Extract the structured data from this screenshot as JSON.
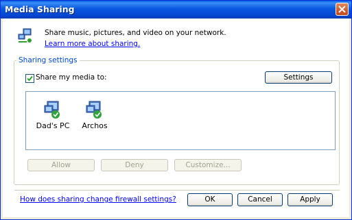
{
  "window": {
    "title": "Media Sharing"
  },
  "intro": {
    "text": "Share music, pictures, and video on your network.",
    "learn_more_link": "Learn more about sharing."
  },
  "sharing_settings": {
    "legend": "Sharing settings",
    "share_media_label": "Share my media to:",
    "share_media_checked": true,
    "settings_button": "Settings",
    "devices": [
      {
        "label": "Dad's PC",
        "icon": "computer-check-icon"
      },
      {
        "label": "Archos",
        "icon": "computer-check-icon"
      }
    ],
    "allow_button": "Allow",
    "deny_button": "Deny",
    "customize_button": "Customize..."
  },
  "footer": {
    "firewall_link": "How does sharing change firewall settings?",
    "ok_button": "OK",
    "cancel_button": "Cancel",
    "apply_button": "Apply"
  },
  "colors": {
    "titlebar": "#0a58e0",
    "link": "#0000ff",
    "group_legend": "#0046d5"
  }
}
